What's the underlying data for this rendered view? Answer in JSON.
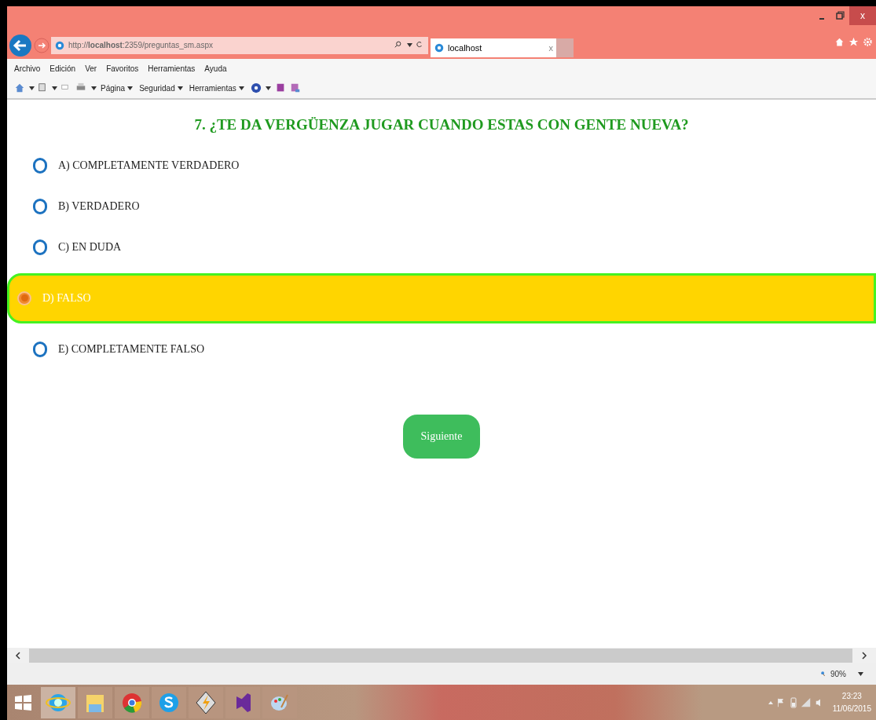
{
  "browser": {
    "address": "http://**localhost**:2359/preguntas_sm.aspx",
    "tab": {
      "title": "localhost",
      "close": "x"
    },
    "window_close": "x"
  },
  "menu_bar": [
    "Archivo",
    "Edición",
    "Ver",
    "Favoritos",
    "Herramientas",
    "Ayuda"
  ],
  "command_bar": [
    "Página",
    "Seguridad",
    "Herramientas"
  ],
  "question": "7. ¿TE DA VERGÜENZA JUGAR CUANDO ESTAS CON GENTE NUEVA?",
  "options": [
    {
      "label": "A) COMPLETAMENTE VERDADERO",
      "selected": false
    },
    {
      "label": "B) VERDADERO",
      "selected": false
    },
    {
      "label": "C) EN DUDA",
      "selected": false
    },
    {
      "label": "D) FALSO",
      "selected": true
    },
    {
      "label": "E) COMPLETAMENTE FALSO",
      "selected": false
    }
  ],
  "next_button": "Siguiente",
  "status_bar": {
    "zoom": "90%"
  },
  "clock": {
    "time": "23:23",
    "date": "11/06/2015"
  }
}
